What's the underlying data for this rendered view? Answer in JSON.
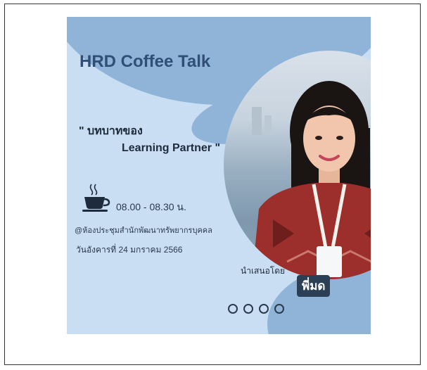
{
  "poster": {
    "title": "HRD Coffee Talk",
    "topic_line1": "\" บทบาทของ",
    "topic_line2": "Learning Partner \"",
    "time": "08.00 - 08.30 น.",
    "venue": "@ห้องประชุมสำนักพัฒนาทรัพยากรบุคคล",
    "date": "วันอังคารที่ 24 มกราคม 2566",
    "presented_by": "นำเสนอโดย",
    "speaker": "พี่มด",
    "time_icon": "coffee-cup-icon",
    "slide_count": 4
  },
  "colors": {
    "background": "#c9def2",
    "accent_blob": "#8fb4d7",
    "title_text": "#2f4f77",
    "speaker_badge": "#2b3f55"
  }
}
